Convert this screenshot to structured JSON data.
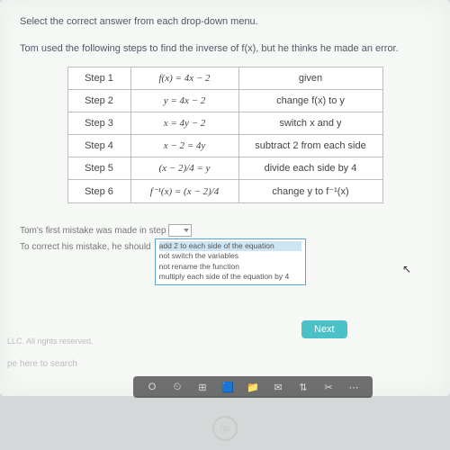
{
  "instruction": "Select the correct answer from each drop-down menu.",
  "prompt": "Tom used the following steps to find the inverse of f(x), but he thinks he made an error.",
  "steps": [
    {
      "label": "Step 1",
      "expr": "f(x) = 4x − 2",
      "reason": "given"
    },
    {
      "label": "Step 2",
      "expr": "y = 4x − 2",
      "reason": "change f(x) to y"
    },
    {
      "label": "Step 3",
      "expr": "x = 4y − 2",
      "reason": "switch x and y"
    },
    {
      "label": "Step 4",
      "expr": "x − 2 = 4y",
      "reason": "subtract 2 from each side"
    },
    {
      "label": "Step 5",
      "expr": "(x − 2)/4 = y",
      "reason": "divide each side by 4"
    },
    {
      "label": "Step 6",
      "expr": "f⁻¹(x) = (x − 2)/4",
      "reason": "change y to f⁻¹(x)"
    }
  ],
  "answer_line1_pre": "Tom's first mistake was made in step",
  "answer_line2_pre": "To correct his mistake, he should",
  "dd2_options": [
    "add 2 to each side of the equation",
    "not switch the variables",
    "not rename the function",
    "multiply each side of the equation by 4"
  ],
  "next_label": "Next",
  "copyright": "LLC. All rights reserved.",
  "search_hint": "pe here to search",
  "taskbar_icons": [
    "O",
    "⏲",
    "⊞",
    "🟦",
    "📁",
    "✉",
    "⇅",
    "✂",
    "⋯"
  ],
  "hp": "hp"
}
